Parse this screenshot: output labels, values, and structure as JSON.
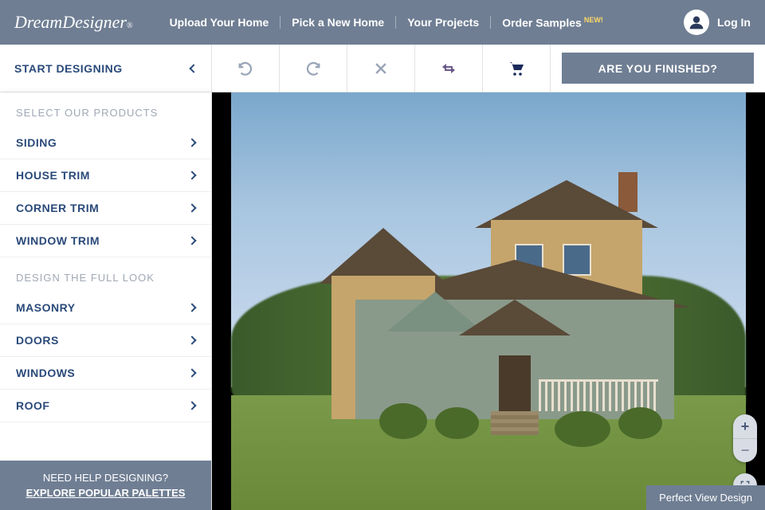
{
  "logo": {
    "part1": "Dream",
    "part2": "Designer",
    "registered": "®"
  },
  "nav": {
    "upload": "Upload Your Home",
    "pick": "Pick a New Home",
    "projects": "Your Projects",
    "samples": "Order Samples",
    "new_badge": "NEW!",
    "login": "Log In"
  },
  "toolbar": {
    "start_designing": "START DESIGNING",
    "finished": "ARE YOU FINISHED?"
  },
  "sidebar": {
    "section1_header": "SELECT OUR PRODUCTS",
    "section1": {
      "siding": "SIDING",
      "house_trim": "HOUSE TRIM",
      "corner_trim": "CORNER TRIM",
      "window_trim": "WINDOW TRIM"
    },
    "section2_header": "DESIGN THE FULL LOOK",
    "section2": {
      "masonry": "MASONRY",
      "doors": "DOORS",
      "windows": "WINDOWS",
      "roof": "ROOF"
    },
    "help": {
      "question": "NEED HELP DESIGNING?",
      "link": "EXPLORE POPULAR PALETTES"
    }
  },
  "canvas": {
    "perfect_view": "Perfect View Design",
    "zoom_in": "+",
    "zoom_out": "−"
  },
  "colors": {
    "header_bg": "#6f7e93",
    "accent": "#2a4a7a"
  }
}
